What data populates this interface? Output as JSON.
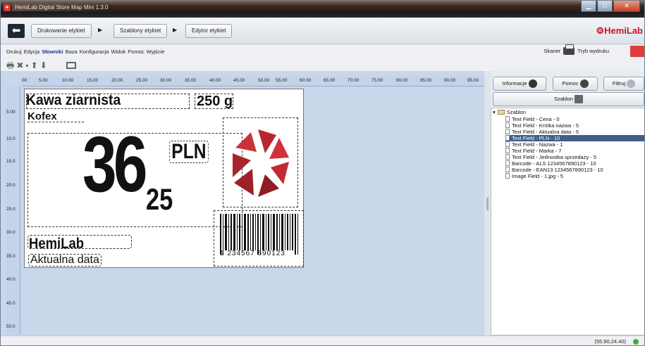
{
  "window": {
    "title": "HemiLab Digital Store Map Mini 1.3.0"
  },
  "nav": {
    "back_icon": "arrow-left-icon",
    "steps": [
      "Drukowanie etykiet",
      "Szablony etykiet",
      "Edytor etykiet"
    ],
    "brand": "HemiLab"
  },
  "menu": {
    "items": [
      "Drukuj",
      "Edycja",
      "Słowniki",
      "Baza",
      "Konfiguracja",
      "Widok",
      "Pomoc",
      "Wyjście"
    ],
    "active": "Słowniki",
    "scanner_label": "Skaner",
    "mode_label": "Tryb wydruku"
  },
  "ruler": {
    "h": [
      "00",
      "5.00",
      "10.00",
      "15.00",
      "20.00",
      "25.00",
      "30.00",
      "35.00",
      "40.00",
      "45.00",
      "50.00",
      "55.00",
      "60.00",
      "65.00",
      "70.00",
      "75.00",
      "80.00",
      "85.00",
      "90.00",
      "95.00"
    ],
    "v": [
      "5.00",
      "10.0",
      "15.0",
      "20.0",
      "25.0",
      "30.0",
      "35.0",
      "40.0",
      "45.0",
      "50.0"
    ]
  },
  "label": {
    "product_name": "Kawa ziarnista",
    "weight": "250 g",
    "brand": "Kofex",
    "price_main": "36",
    "price_cents": "25",
    "currency": "PLN",
    "shop_name": "HemiLab",
    "date": "Aktualna data",
    "barcode_digits": "1 234567 890123"
  },
  "panel": {
    "tabs": [
      "Informacje",
      "Pomoc",
      "Filtruj"
    ],
    "template_btn": "Szablon",
    "tree_root": "Szablon",
    "tree_items": [
      "Text Field - Cena - 0",
      "Text Field - Krótka nazwa - 5",
      "Text Field - Aktualna data - 5",
      "Text Field - PLN - 10",
      "Text Field - Nazwa - 1",
      "Text Field - Marka - 7",
      "Text Field - Jednostka sprzedaży - 5",
      "Barcode - ALS 1234567890123 - 10",
      "Barcode - EAN13 1234567890123 - 10",
      "Image Field - 1.jpg - 5"
    ],
    "selected_index": 3
  },
  "status": {
    "coords": "(55.90,24.40)"
  },
  "colors": {
    "brand": "#c9142a",
    "selection": "#3f5f8a",
    "status_ok": "#3cb33c"
  }
}
